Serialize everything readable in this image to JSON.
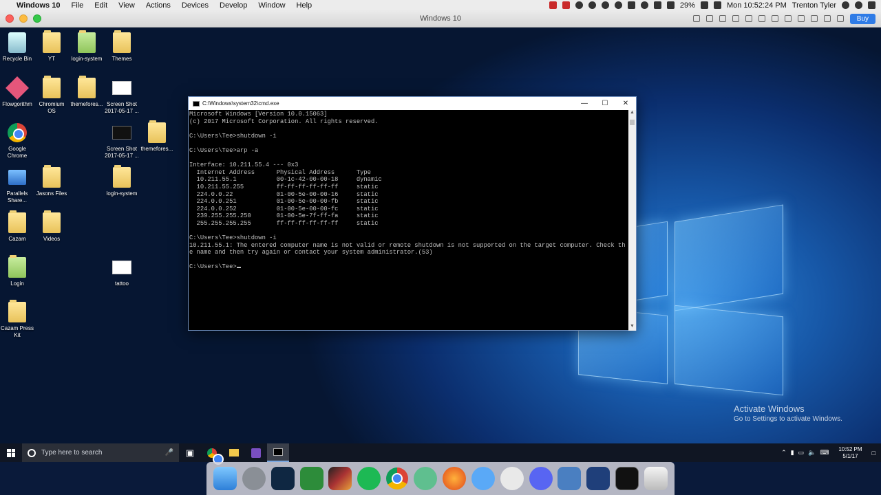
{
  "mac_menubar": {
    "app_name": "Windows 10",
    "menus": [
      "File",
      "Edit",
      "View",
      "Actions",
      "Devices",
      "Develop",
      "Window",
      "Help"
    ],
    "battery": "29%",
    "datetime": "Mon 10:52:24 PM",
    "user": "Trenton Tyler"
  },
  "vm_window": {
    "title": "Windows 10",
    "buy_label": "Buy"
  },
  "desktop_icons": [
    {
      "label": "Recycle Bin"
    },
    {
      "label": "YT"
    },
    {
      "label": "login-system"
    },
    {
      "label": "Themes"
    },
    {
      "label": "Flowgorithm"
    },
    {
      "label": "Chromium OS"
    },
    {
      "label": "themefores..."
    },
    {
      "label": "Screen Shot 2017-05-17 ..."
    },
    {
      "label": "Google Chrome"
    },
    {
      "label": "Screen Shot 2017-05-17 ..."
    },
    {
      "label": "themefores..."
    },
    {
      "label": "Parallels Share..."
    },
    {
      "label": "Jasons Files"
    },
    {
      "label": "login-system"
    },
    {
      "label": "Cazam"
    },
    {
      "label": "Videos"
    },
    {
      "label": "Login"
    },
    {
      "label": "tattoo"
    },
    {
      "label": "Cazam Press Kit"
    }
  ],
  "cmd": {
    "title": "C:\\Windows\\system32\\cmd.exe",
    "lines": [
      "Microsoft Windows [Version 10.0.15063]",
      "(c) 2017 Microsoft Corporation. All rights reserved.",
      "",
      "C:\\Users\\Tee>shutdown -i",
      "",
      "C:\\Users\\Tee>arp -a",
      "",
      "Interface: 10.211.55.4 --- 0x3",
      "  Internet Address      Physical Address      Type",
      "  10.211.55.1           00-1c-42-00-00-18     dynamic",
      "  10.211.55.255         ff-ff-ff-ff-ff-ff     static",
      "  224.0.0.22            01-00-5e-00-00-16     static",
      "  224.0.0.251           01-00-5e-00-00-fb     static",
      "  224.0.0.252           01-00-5e-00-00-fc     static",
      "  239.255.255.250       01-00-5e-7f-ff-fa     static",
      "  255.255.255.255       ff-ff-ff-ff-ff-ff     static",
      "",
      "C:\\Users\\Tee>shutdown -i",
      "10.211.55.1: The entered computer name is not valid or remote shutdown is not supported on the target computer. Check th",
      "e name and then try again or contact your system administrator.(53)",
      "",
      "C:\\Users\\Tee>"
    ]
  },
  "activation": {
    "title": "Activate Windows",
    "subtitle": "Go to Settings to activate Windows."
  },
  "taskbar": {
    "search_placeholder": "Type here to search",
    "clock_time": "10:52 PM",
    "clock_date": "5/1/17"
  },
  "dock_apps": [
    "finder-icon",
    "system-preferences-icon",
    "photoshop-icon",
    "camtasia-icon",
    "final-cut-icon",
    "spotify-icon",
    "chrome-icon",
    "atom-icon",
    "firefox-icon",
    "messages-icon",
    "sequel-pro-icon",
    "discord-icon",
    "parallels-icon",
    "virtualbox-icon",
    "terminal-icon",
    "trash-icon"
  ]
}
